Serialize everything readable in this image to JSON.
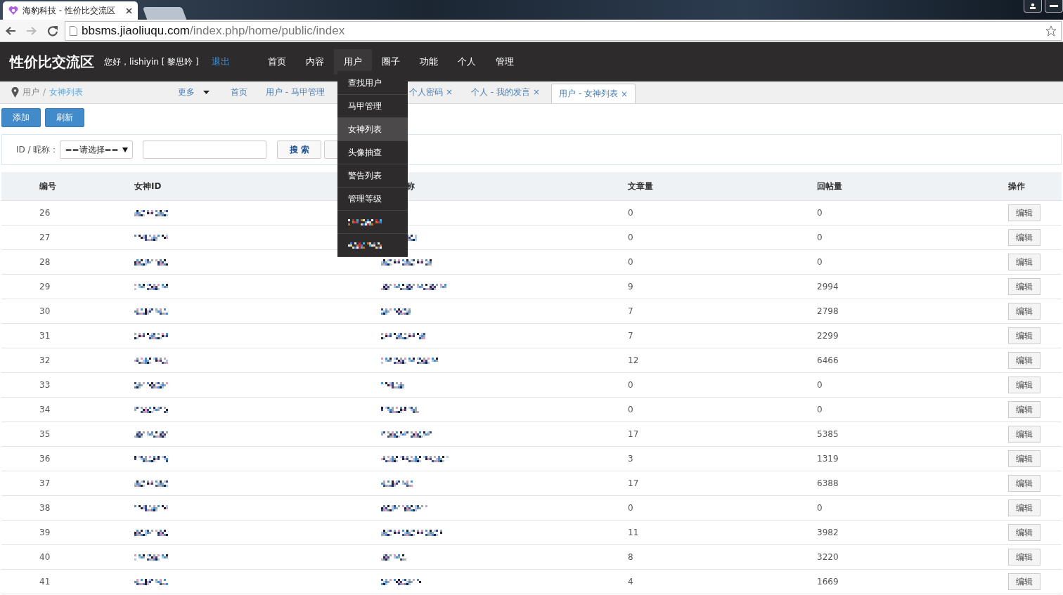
{
  "browser": {
    "tab_title": "海豹科技 - 性价比交流区",
    "url_host": "bbsms.jiaoliuqu.com",
    "url_path": "/index.php/home/public/index"
  },
  "site": {
    "logo": "性价比交流区",
    "greeting": "您好，lishiyin [ 黎思吟 ]",
    "logout": "退出",
    "nav": [
      {
        "label": "首页",
        "selected": false
      },
      {
        "label": "内容",
        "selected": false
      },
      {
        "label": "用户",
        "selected": true
      },
      {
        "label": "圈子",
        "selected": false
      },
      {
        "label": "功能",
        "selected": false
      },
      {
        "label": "个人",
        "selected": false
      },
      {
        "label": "管理",
        "selected": false
      }
    ]
  },
  "dropdown": [
    {
      "kind": "text",
      "label": "查找用户",
      "selected": false
    },
    {
      "kind": "text",
      "label": "马甲管理",
      "selected": false
    },
    {
      "kind": "text",
      "label": "女神列表",
      "selected": true
    },
    {
      "kind": "text",
      "label": "头像抽查",
      "selected": false
    },
    {
      "kind": "text",
      "label": "警告列表",
      "selected": false
    },
    {
      "kind": "text",
      "label": "管理等级",
      "selected": false
    },
    {
      "kind": "pixelated",
      "selected": false
    },
    {
      "kind": "pixelated",
      "selected": false
    }
  ],
  "breadcrumb": [
    "用户",
    "女神列表"
  ],
  "breadcrumb_separator": "/",
  "more": "更多",
  "page_tabs": [
    {
      "label": "首页",
      "selected": false
    },
    {
      "label": "用户 - 马甲管理",
      "selected": false
    },
    {
      "label": "个人密码",
      "close": "×",
      "selected": false
    },
    {
      "label": "个人 - 我的发言",
      "close": "×",
      "selected": false
    },
    {
      "label": "用户 - 女神列表",
      "close": "×",
      "selected": true
    }
  ],
  "toolbar": [
    "添加",
    "刷新"
  ],
  "filter": {
    "label": "ID / 昵称：",
    "select": "==请选择==",
    "search": "搜 索"
  },
  "table": {
    "columns": [
      "编号",
      "女神ID",
      "称",
      "文章量",
      "回帖量",
      "操作"
    ],
    "rows": [
      {
        "no": "26",
        "articles": "0",
        "replies": "0",
        "action": "编辑"
      },
      {
        "no": "27",
        "articles": "0",
        "replies": "0",
        "action": "编辑"
      },
      {
        "no": "28",
        "articles": "0",
        "replies": "0",
        "action": "编辑"
      },
      {
        "no": "29",
        "articles": "9",
        "replies": "2994",
        "action": "编辑"
      },
      {
        "no": "30",
        "articles": "7",
        "replies": "2798",
        "action": "编辑"
      },
      {
        "no": "31",
        "articles": "7",
        "replies": "2299",
        "action": "编辑"
      },
      {
        "no": "32",
        "articles": "12",
        "replies": "6466",
        "action": "编辑"
      },
      {
        "no": "33",
        "articles": "0",
        "replies": "0",
        "action": "编辑"
      },
      {
        "no": "34",
        "articles": "0",
        "replies": "0",
        "action": "编辑"
      },
      {
        "no": "35",
        "articles": "17",
        "replies": "5385",
        "action": "编辑"
      },
      {
        "no": "36",
        "articles": "3",
        "replies": "1319",
        "action": "编辑"
      },
      {
        "no": "37",
        "articles": "17",
        "replies": "6388",
        "action": "编辑"
      },
      {
        "no": "38",
        "articles": "0",
        "replies": "0",
        "action": "编辑"
      },
      {
        "no": "39",
        "articles": "11",
        "replies": "3982",
        "action": "编辑"
      },
      {
        "no": "40",
        "articles": "8",
        "replies": "3220",
        "action": "编辑"
      },
      {
        "no": "41",
        "articles": "4",
        "replies": "1669",
        "action": "编辑"
      }
    ]
  }
}
